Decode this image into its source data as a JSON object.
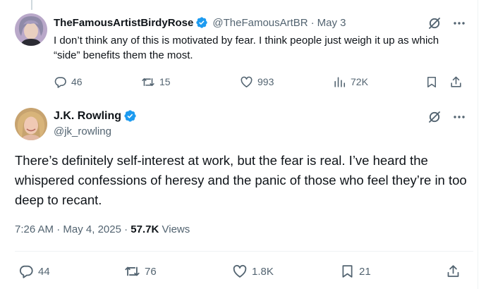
{
  "reply": {
    "display_name": "TheFamousArtistBirdyRose",
    "handle": "@TheFamousArtBR",
    "separator": "·",
    "date": "May 3",
    "text": "I don’t think any of this is motivated by fear. I think people just weigh it up as which “side” benefits them the most.",
    "actions": {
      "replies": "46",
      "reposts": "15",
      "likes": "993",
      "views": "72K"
    }
  },
  "main_post": {
    "display_name": "J.K. Rowling",
    "handle": "@jk_rowling",
    "text": "There’s definitely self-interest at work, but the fear is real. I’ve heard the whispered confessions of heresy and the panic of those who feel they’re in too deep to recant.",
    "time": "7:26 AM",
    "separator": "·",
    "date": "May 4, 2025",
    "views_count": "57.7K",
    "views_label": "Views",
    "actions": {
      "replies": "44",
      "reposts": "76",
      "likes": "1.8K",
      "bookmarks": "21"
    }
  },
  "colors": {
    "text_primary": "#0f1419",
    "text_secondary": "#536471",
    "verified_blue": "#1d9bf0",
    "border": "#eff3f4"
  }
}
